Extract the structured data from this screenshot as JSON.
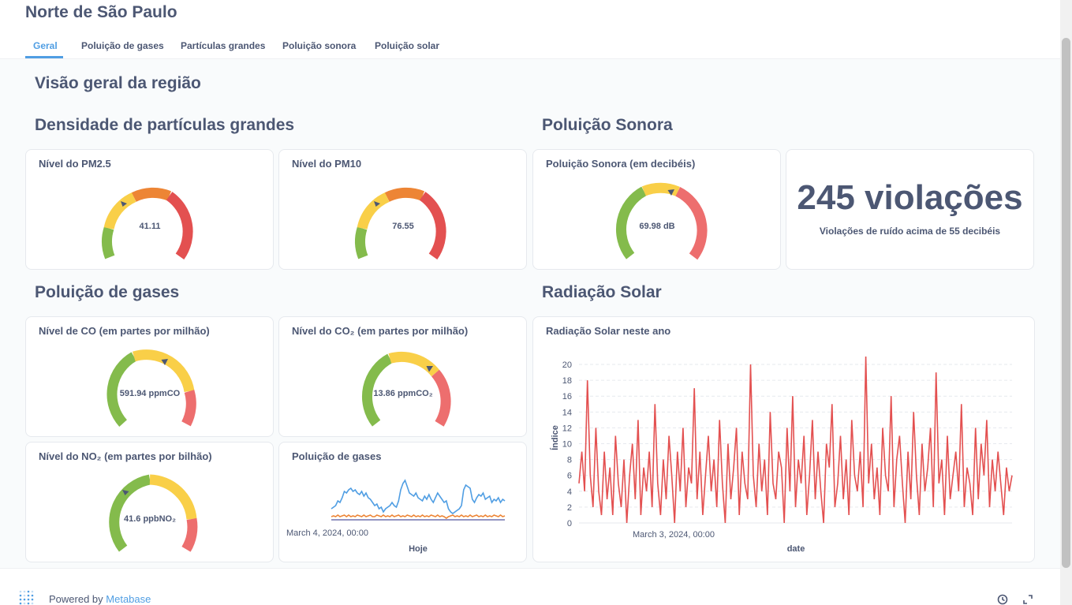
{
  "header": {
    "title": "Norte de São Paulo",
    "tabs": [
      {
        "label": "Geral",
        "active": true
      },
      {
        "label": "Poluição de gases",
        "active": false
      },
      {
        "label": "Partículas grandes",
        "active": false
      },
      {
        "label": "Poluição sonora",
        "active": false
      },
      {
        "label": "Poluição solar",
        "active": false
      }
    ]
  },
  "page": {
    "overview_title": "Visão geral da região",
    "sections": {
      "particles": "Densidade de partículas grandes",
      "noise": "Poluição Sonora",
      "gases": "Poluição de gases",
      "solar": "Radiação Solar"
    }
  },
  "cards": {
    "pm25": {
      "title": "Nível do PM2.5",
      "value_label": "41.11",
      "value": 41.11
    },
    "pm10": {
      "title": "Nível do PM10",
      "value_label": "76.55",
      "value": 76.55
    },
    "noise_gauge": {
      "title": "Poluição Sonora (em decibéis)",
      "value_label": "69.98 dB",
      "value": 69.98
    },
    "violations": {
      "number": "245 violações",
      "caption": "Violações de ruído acima de 55 decibéis"
    },
    "co": {
      "title": "Nível de CO (em partes por milhão)",
      "value_label": "591.94 ppmCO",
      "value": 591.94
    },
    "co2": {
      "title": "Nível do CO₂ (em partes por milhão)",
      "value_label": "13.86 ppmCO₂",
      "value": 13.86
    },
    "no2": {
      "title": "Nível do NO₂ (em partes por bilhão)",
      "value_label": "41.6 ppbNO₂",
      "value": 41.6
    },
    "gases_chart": {
      "title": "Poluição de gases",
      "x_tick": "March 4, 2024, 00:00",
      "xlabel": "Hoje"
    },
    "solar_chart": {
      "title": "Radiação Solar neste ano",
      "x_tick": "March 3, 2024, 00:00",
      "xlabel": "date",
      "ylabel": "Índice"
    }
  },
  "colors": {
    "green": "#84bb4c",
    "yellow": "#f9cf48",
    "orange": "#ed8535",
    "red": "#e35050",
    "pink": "#ed6e6e",
    "blue": "#509ee3",
    "solar_line": "#e35050"
  },
  "footer": {
    "powered_by": "Powered by",
    "brand": "Metabase"
  },
  "chart_data": [
    {
      "type": "line",
      "title": "Radiação Solar neste ano",
      "xlabel": "date",
      "ylabel": "Índice",
      "ylim": [
        0,
        21
      ],
      "yticks": [
        0,
        2,
        4,
        6,
        8,
        10,
        12,
        14,
        16,
        18,
        20
      ],
      "x_tick_labels": [
        "March 3, 2024, 00:00"
      ],
      "grid": true,
      "series": [
        {
          "values": [
            5,
            9,
            4,
            18,
            6,
            2,
            12,
            4,
            1,
            9,
            3,
            7,
            1,
            11,
            5,
            2,
            8,
            0,
            6,
            10,
            3,
            13,
            1,
            7,
            4,
            9,
            2,
            15,
            5,
            1,
            8,
            3,
            11,
            6,
            0,
            9,
            4,
            12,
            2,
            7,
            5,
            17,
            3,
            9,
            1,
            6,
            11,
            4,
            8,
            2,
            13,
            5,
            0,
            10,
            3,
            7,
            12,
            1,
            9,
            5,
            3,
            20,
            6,
            2,
            10,
            4,
            8,
            1,
            14,
            5,
            3,
            9,
            7,
            0,
            12,
            4,
            16,
            2,
            8,
            5,
            11,
            1,
            6,
            13,
            3,
            9,
            4,
            0,
            10,
            7,
            15,
            2,
            5,
            11,
            3,
            8,
            1,
            13,
            6,
            4,
            9,
            2,
            21,
            5,
            10,
            3,
            7,
            1,
            12,
            6,
            4,
            16,
            2,
            8,
            11,
            5,
            0,
            9,
            3,
            14,
            6,
            1,
            10,
            4,
            7,
            12,
            2,
            19,
            5,
            8,
            1,
            11,
            3,
            6,
            9,
            4,
            15,
            2,
            7,
            5,
            1,
            12,
            3,
            10,
            6,
            13,
            2,
            8,
            4,
            9,
            5,
            1,
            7,
            4,
            6
          ]
        }
      ]
    },
    {
      "type": "line",
      "title": "Poluição de gases",
      "xlabel": "Hoje",
      "x_tick_labels": [
        "March 4, 2024, 00:00"
      ],
      "series": [
        {
          "values": [
            8,
            9,
            10,
            13,
            12,
            15,
            19,
            18,
            20,
            21,
            19,
            20,
            18,
            17,
            19,
            16,
            18,
            15,
            14,
            12,
            10,
            11,
            8,
            9,
            6,
            8,
            9,
            10,
            12,
            10,
            9,
            13,
            20,
            24,
            26,
            22,
            18,
            17,
            16,
            18,
            15,
            14,
            13,
            16,
            14,
            17,
            14,
            12,
            15,
            18,
            16,
            14,
            12,
            13,
            8,
            6,
            5,
            6,
            7,
            8,
            10,
            20,
            23,
            22,
            21,
            14,
            12,
            15,
            17,
            16,
            18,
            14,
            15,
            16,
            12,
            14,
            13,
            15,
            12,
            14,
            13
          ]
        },
        {
          "values": [
            3,
            3.5,
            3,
            4,
            3,
            3.5,
            4,
            3,
            4,
            3,
            3.5,
            3,
            4,
            3.5,
            3,
            4,
            3,
            3.5,
            4,
            3,
            3,
            4,
            3.5,
            3,
            4,
            3,
            3.5,
            3,
            4,
            3,
            3.5,
            4,
            3,
            3.5,
            3,
            4,
            3.5,
            3,
            4,
            3,
            3.5,
            3,
            4,
            3,
            3.5,
            3,
            4,
            3.5,
            3,
            4,
            3,
            3.5,
            3,
            2,
            3,
            3.5,
            4,
            3,
            3.5,
            3,
            4,
            3,
            3.5,
            3,
            4,
            3,
            3.5,
            4,
            3,
            3.5,
            3,
            4,
            3,
            3.5,
            3,
            4,
            3.5,
            3,
            4,
            3,
            3.5
          ]
        },
        {
          "values": [
            1,
            1,
            1,
            1,
            1,
            1,
            1,
            1,
            1,
            1,
            1,
            1,
            1,
            1,
            1,
            1,
            1,
            1,
            1,
            1,
            1,
            1,
            1,
            1,
            1,
            1,
            1,
            1,
            1,
            1,
            1,
            1,
            1,
            1,
            1,
            1,
            1,
            1,
            1,
            1,
            1,
            1,
            1,
            1,
            1,
            1,
            1,
            1,
            1,
            1,
            1,
            1,
            1,
            1,
            1,
            1,
            1,
            1,
            1,
            1,
            1,
            1,
            1,
            1,
            1,
            1,
            1,
            1,
            1,
            1,
            1,
            1,
            1,
            1,
            1,
            1,
            1,
            1,
            1,
            1,
            1
          ]
        }
      ]
    }
  ]
}
